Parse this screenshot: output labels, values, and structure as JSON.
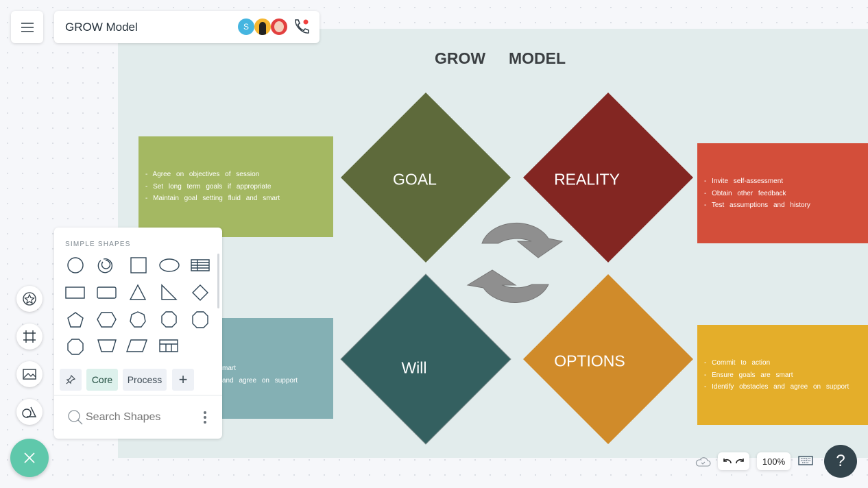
{
  "header": {
    "title": "GROW Model",
    "avatar_initial": "S",
    "menu_icon": "hamburger-icon",
    "call_icon": "phone-icon"
  },
  "diagram": {
    "title_left": "GROW",
    "title_right": "MODEL",
    "quadrants": [
      {
        "label": "GOAL",
        "color": "#5e6a3b"
      },
      {
        "label": "REALITY",
        "color": "#832622"
      },
      {
        "label": "Will",
        "color": "#346060"
      },
      {
        "label": "OPTIONS",
        "color": "#d08b2a"
      }
    ],
    "boxes": {
      "goal": {
        "color": "#a4b862",
        "lines": [
          "- Agree on objectives of session",
          "- Set long term goals if appropriate",
          "- Maintain goal setting fluid and smart"
        ]
      },
      "reality": {
        "color": "#d34e3a",
        "lines": [
          "- Invite self-assessment",
          "- Obtain other feedback",
          "- Test assumptions and history"
        ]
      },
      "will": {
        "color": "#84b0b4",
        "lines": [
          "mart",
          "and agree on support"
        ]
      },
      "options": {
        "color": "#e4ae2a",
        "lines": [
          "- Commit to action",
          "- Ensure goals are smart",
          "- Identify obstacles and agree on support"
        ]
      }
    }
  },
  "shapes_panel": {
    "section": "SIMPLE SHAPES",
    "tabs": [
      "Core",
      "Process"
    ],
    "search_placeholder": "Search Shapes"
  },
  "bottom_bar": {
    "zoom": "100%",
    "help": "?"
  }
}
